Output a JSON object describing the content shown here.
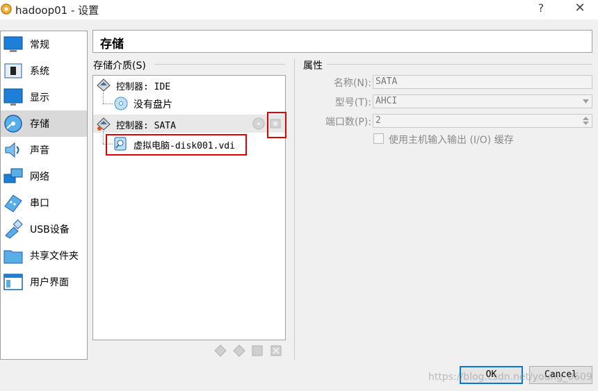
{
  "window": {
    "title": "hadoop01 - 设置",
    "help_label": "?",
    "close_label": "✕"
  },
  "sidebar": {
    "items": [
      {
        "label": "常规",
        "icon": "general-monitor-icon"
      },
      {
        "label": "系统",
        "icon": "system-chip-icon"
      },
      {
        "label": "显示",
        "icon": "display-monitor-icon"
      },
      {
        "label": "存储",
        "icon": "storage-disk-icon",
        "selected": true
      },
      {
        "label": "声音",
        "icon": "audio-speaker-icon"
      },
      {
        "label": "网络",
        "icon": "network-icon"
      },
      {
        "label": "串口",
        "icon": "serial-port-icon"
      },
      {
        "label": "USB设备",
        "icon": "usb-icon"
      },
      {
        "label": "共享文件夹",
        "icon": "shared-folder-icon"
      },
      {
        "label": "用户界面",
        "icon": "user-interface-icon"
      }
    ]
  },
  "page": {
    "title": "存储"
  },
  "storage": {
    "group_label": "存储介质(S)",
    "tree": {
      "ide_controller": "控制器: IDE",
      "ide_child": "没有盘片",
      "sata_controller": "控制器: SATA",
      "sata_child": "虚拟电脑-disk001.vdi"
    }
  },
  "attributes": {
    "group_label": "属性",
    "name_label": "名称(N):",
    "name_value": "SATA",
    "type_label": "型号(T):",
    "type_value": "AHCI",
    "port_label": "端口数(P):",
    "port_value": "2",
    "cache_label": "使用主机输入输出 (I/O) 缓存",
    "cache_checked": false
  },
  "buttons": {
    "ok": "OK",
    "cancel": "Cancel"
  },
  "watermark": "https://blog.csdn.net/young_0609",
  "colors": {
    "highlight_box": "#e00000",
    "selected_bg": "#d9d9d9",
    "accent": "#0078d7"
  }
}
